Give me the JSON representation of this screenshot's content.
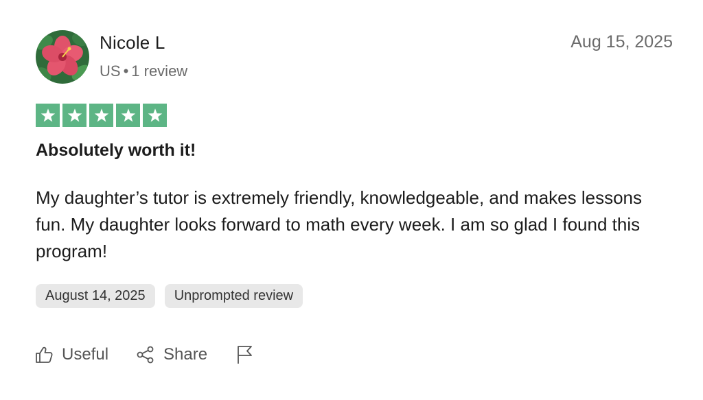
{
  "reviewer": {
    "name": "Nicole L",
    "country": "US",
    "separator": "•",
    "review_count": "1 review",
    "avatar": "hibiscus-flower-avatar"
  },
  "review": {
    "date": "Aug 15, 2025",
    "rating": 5,
    "rating_max": 5,
    "title": "Absolutely worth it!",
    "body": "My daughter’s tutor is extremely friendly, knowledgeable, and makes lessons fun. My daughter looks forward to math every week. I am so glad I found this program!",
    "tags": [
      "August 14, 2025",
      "Unprompted review"
    ]
  },
  "actions": {
    "useful_label": "Useful",
    "share_label": "Share",
    "useful_icon": "thumbs-up-icon",
    "share_icon": "share-icon",
    "flag_icon": "flag-icon"
  },
  "colors": {
    "star_green": "#5db585",
    "text_primary": "#1c1c1c",
    "text_secondary": "#6b6b6b",
    "tag_background": "#e8e8e8"
  }
}
